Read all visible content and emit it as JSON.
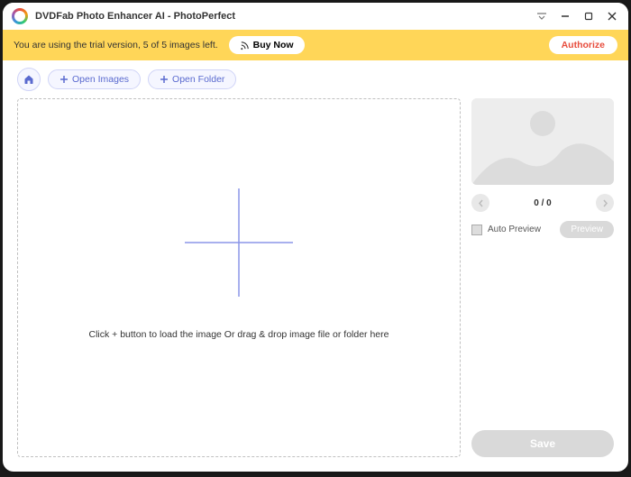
{
  "titlebar": {
    "title": "DVDFab Photo Enhancer AI - PhotoPerfect"
  },
  "trial": {
    "message": "You are using the trial version, 5 of 5 images left.",
    "buy_label": "Buy Now",
    "authorize_label": "Authorize"
  },
  "toolbar": {
    "open_images_label": "Open Images",
    "open_folder_label": "Open Folder"
  },
  "dropzone": {
    "hint": "Click + button to load the image Or drag & drop image file or folder here"
  },
  "sidepanel": {
    "counter": "0 / 0",
    "auto_preview_label": "Auto Preview",
    "preview_btn_label": "Preview",
    "save_label": "Save"
  }
}
